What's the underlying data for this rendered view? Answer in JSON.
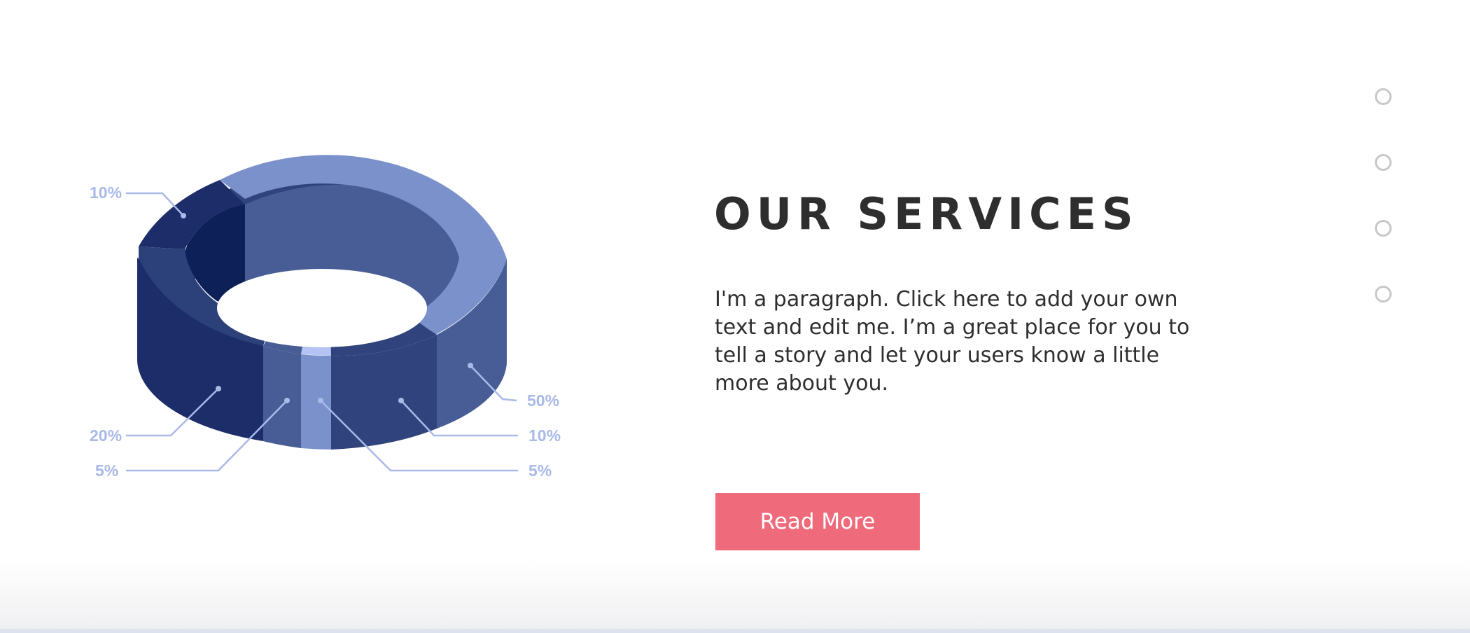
{
  "graphic": {
    "callouts": [
      "10%",
      "50%",
      "20%",
      "10%",
      "5%",
      "5%"
    ],
    "colors": {
      "darkest": "#0d2057",
      "dark": "#1d2d6a",
      "mid": "#2c4079",
      "mid_light": "#485d96",
      "light": "#7b91cb",
      "highlight": "#b2c3f4",
      "label": "#a9b9e8"
    }
  },
  "content": {
    "title": "OUR SERVICES",
    "paragraph": "I'm a paragraph. Click here to add your own text and edit me. I’m a great place for you to tell a story and let your users know a little more about you.",
    "button_label": "Read More",
    "button_color": "#ef6a7a"
  },
  "dot_nav": {
    "count": 4
  }
}
